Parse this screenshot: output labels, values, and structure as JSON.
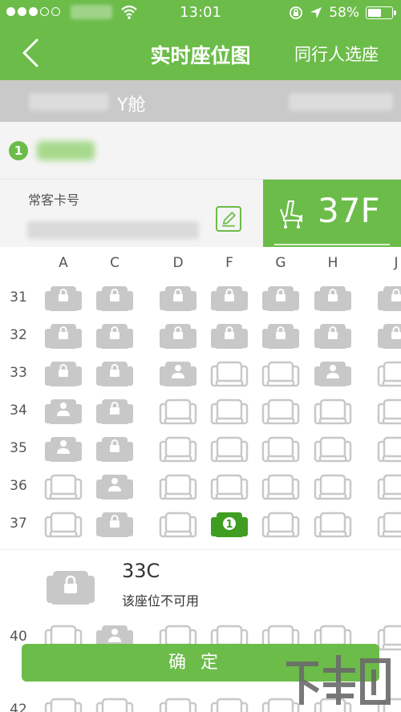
{
  "status_bar": {
    "time": "13:01",
    "battery": "58%",
    "signal_bars_filled": 3,
    "signal_bars_total": 5
  },
  "nav": {
    "title": "实时座位图",
    "companion_button": "同行人选座",
    "back_icon": "chevron-left-icon"
  },
  "cabin": {
    "label": "Y舱"
  },
  "passenger": {
    "index": "1"
  },
  "member": {
    "label": "常客卡号",
    "edit_icon": "edit-icon"
  },
  "selected_seat": {
    "seat": "37F",
    "icon": "seat-icon"
  },
  "seat_map": {
    "columns": [
      "A",
      "C",
      "D",
      "F",
      "G",
      "H",
      "J"
    ],
    "rows": [
      {
        "row": "31",
        "seats": [
          "locked",
          "locked",
          "locked",
          "locked",
          "locked",
          "locked",
          "locked"
        ]
      },
      {
        "row": "32",
        "seats": [
          "locked",
          "locked",
          "locked",
          "locked",
          "locked",
          "locked",
          "locked"
        ]
      },
      {
        "row": "33",
        "seats": [
          "locked",
          "locked",
          "occupied",
          "available",
          "available",
          "occupied",
          "available"
        ]
      },
      {
        "row": "34",
        "seats": [
          "occupied",
          "locked",
          "available",
          "available",
          "available",
          "available",
          "available"
        ]
      },
      {
        "row": "35",
        "seats": [
          "occupied",
          "locked",
          "available",
          "available",
          "available",
          "available",
          "available"
        ]
      },
      {
        "row": "36",
        "seats": [
          "available",
          "occupied",
          "available",
          "available",
          "available",
          "available",
          "available"
        ]
      },
      {
        "row": "37",
        "seats": [
          "available",
          "locked",
          "available",
          "selected",
          "available",
          "available",
          "available"
        ]
      },
      {
        "row": "40",
        "seats": [
          "available",
          "occupied",
          "available",
          "available",
          "available",
          "available",
          "available"
        ]
      },
      {
        "row": "42",
        "seats": [
          "available",
          "available",
          "available",
          "available",
          "available",
          "available",
          "available"
        ]
      }
    ],
    "selected_marker": "1"
  },
  "info_panel": {
    "seat": "33C",
    "message": "该座位不可用",
    "icon": "lock-seat-icon"
  },
  "confirm_button": "确定",
  "colors": {
    "brand_green": "#6cbc4a",
    "seat_gray": "#c8c8c8",
    "selected_green": "#3f9e22"
  }
}
